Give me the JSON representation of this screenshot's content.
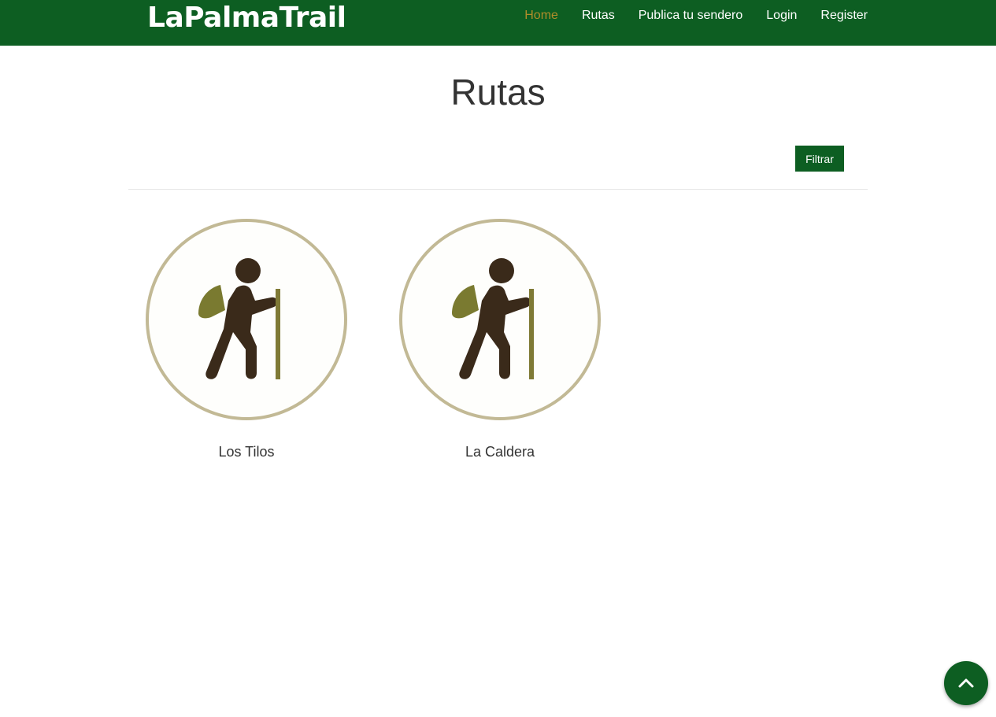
{
  "header": {
    "brand": "LaPalmaTrail",
    "nav": [
      {
        "label": "Home",
        "active": true
      },
      {
        "label": "Rutas",
        "active": false
      },
      {
        "label": "Publica tu sendero",
        "active": false
      },
      {
        "label": "Login",
        "active": false
      },
      {
        "label": "Register",
        "active": false
      }
    ]
  },
  "main": {
    "title": "Rutas",
    "filter_label": "Filtrar",
    "routes": [
      {
        "name": "Los Tilos",
        "icon": "hiker-icon"
      },
      {
        "name": "La Caldera",
        "icon": "hiker-icon"
      }
    ]
  },
  "scroll_top": {
    "icon": "chevron-up-icon"
  },
  "colors": {
    "navbar": "#0d5e22",
    "active_link": "#b08d2a",
    "circle_border": "#c2b995",
    "hiker_body": "#3a2a1a",
    "backpack": "#7a7a30",
    "stick": "#7f7a36"
  }
}
